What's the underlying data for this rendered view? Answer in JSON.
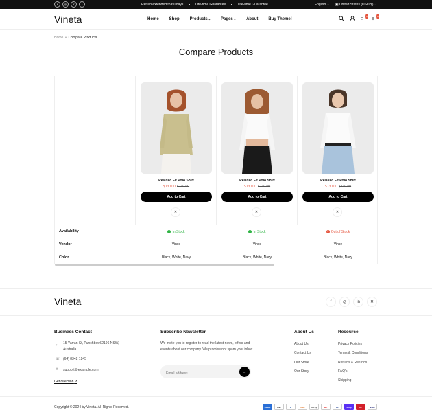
{
  "topbar": {
    "social": [
      "f",
      "◎",
      "𝕏",
      "♪"
    ],
    "messages": [
      "Return extended to 60 days",
      "Life-time Guarantee",
      "Life-time Guarantee"
    ],
    "language": "English",
    "currency": "United States (USD $)"
  },
  "header": {
    "logo": "Vineta",
    "nav": [
      "Home",
      "Shop",
      "Products",
      "Pages",
      "About",
      "Buy Theme!"
    ],
    "wishlist_count": "0",
    "cart_count": "0"
  },
  "breadcrumb": {
    "home": "Home",
    "current": "Compare Products"
  },
  "page_title": "Compare Products",
  "products": [
    {
      "name": "Relaxed Fit Polo Shirt",
      "price": "$130.00",
      "old_price": "$130.00",
      "cart": "Add to Cart",
      "availability": "In Stock",
      "vendor": "Vince",
      "color": "Black, White, Navy",
      "in_stock": true
    },
    {
      "name": "Relaxed Fit Polo Shirt",
      "price": "$130.00",
      "old_price": "$130.00",
      "cart": "Add to Cart",
      "availability": "In Stock",
      "vendor": "Vince",
      "color": "Black, White, Navy",
      "in_stock": true
    },
    {
      "name": "Relaxed Fit Polo Shirt",
      "price": "$130.00",
      "old_price": "$130.00",
      "cart": "Add to Cart",
      "availability": "Out of Stock",
      "vendor": "Vince",
      "color": "Black, White, Navy",
      "in_stock": false
    }
  ],
  "rows": {
    "availability": "Availability",
    "vendor": "Vendor",
    "color": "Color"
  },
  "footer": {
    "logo": "Vineta",
    "business": {
      "heading": "Business Contact",
      "address": "15 Yarran St, Punchbowl 2196 NSW, Australia",
      "phone": "(64) 8342 1245",
      "email": "support@example.com",
      "direction": "Get direction"
    },
    "newsletter": {
      "heading": "Subscribe Newsletter",
      "text": "We invite you to register to read the latest news, offers and events about our company. We promise not spam your inbox.",
      "placeholder": "Email address"
    },
    "about": {
      "heading": "About Us",
      "links": [
        "About Us",
        "Contact Us",
        "Our Store",
        "Our Story"
      ]
    },
    "resource": {
      "heading": "Resource",
      "links": [
        "Privacy Policies",
        "Terms & Conditions",
        "Returns & Refunds",
        "FAQ's",
        "Shipping"
      ]
    },
    "copyright": "Copyright © 2024 by Vineta. All Rights Reserved.",
    "payments": [
      "AMEX",
      "Pay",
      "D",
      "DISC",
      "G Pay",
      "MC",
      "PP",
      "shop",
      "UP",
      "VISA"
    ]
  },
  "colors": {
    "accent": "#e5553e",
    "in_stock": "#2fb344",
    "dark": "#111111"
  }
}
